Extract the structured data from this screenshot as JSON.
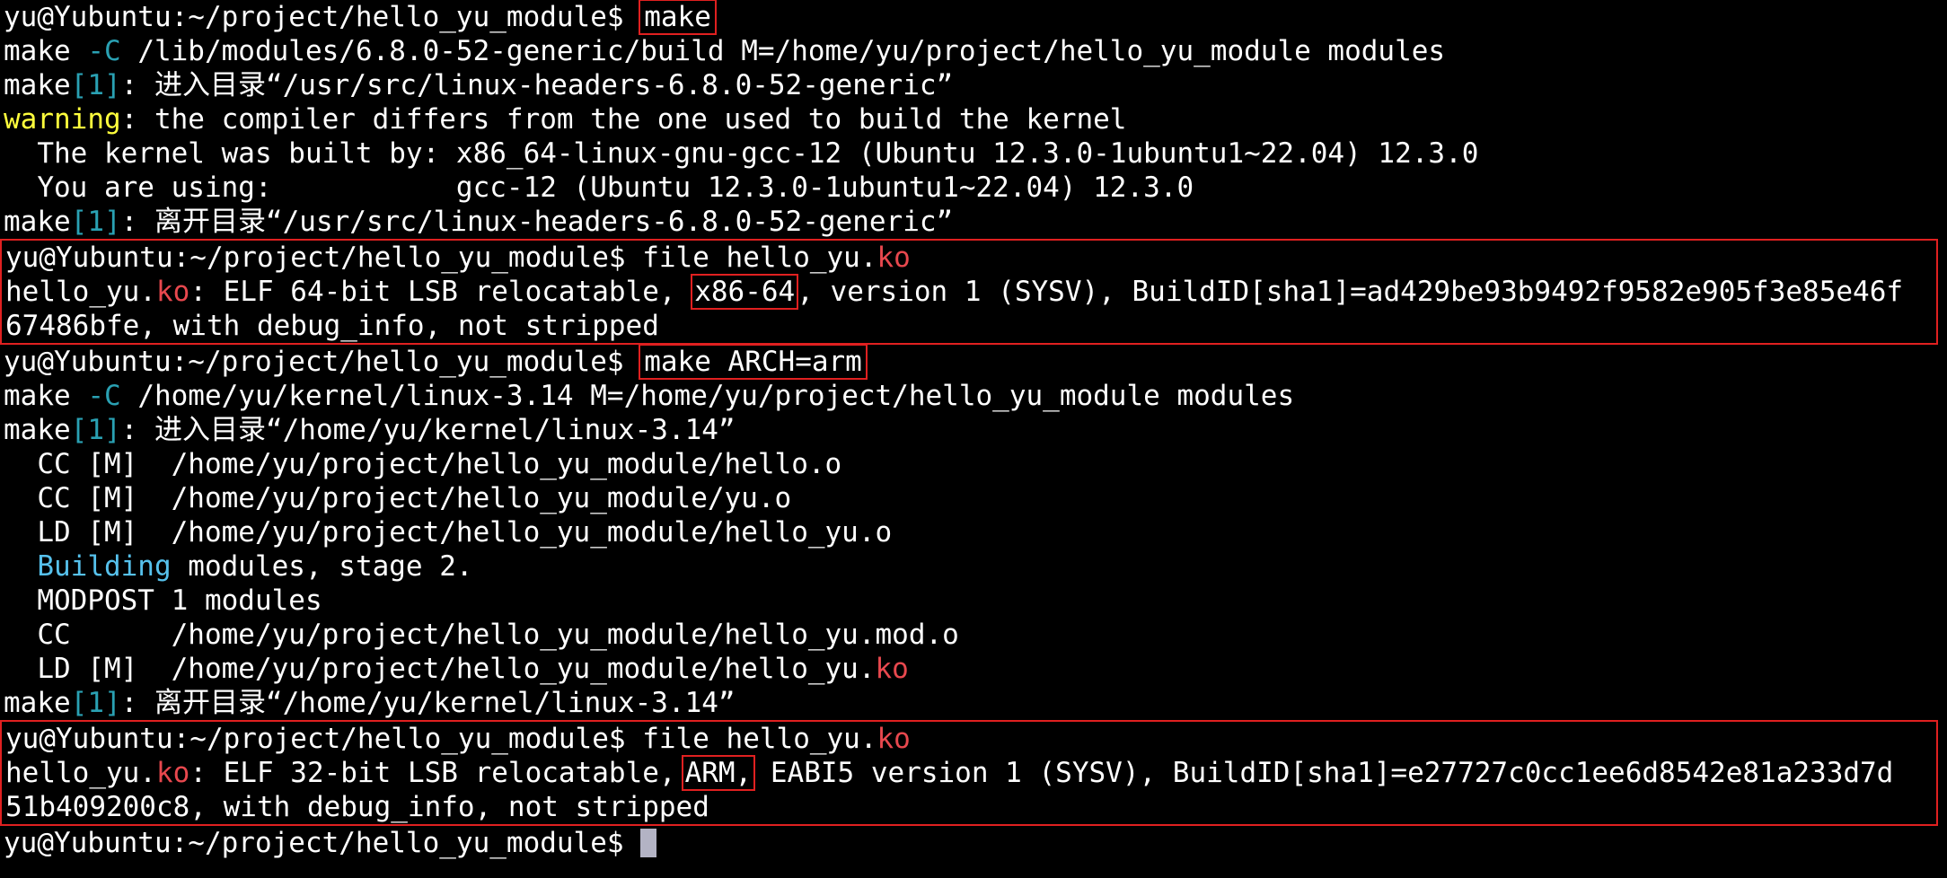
{
  "prompt": "yu@Yubuntu:~/project/hello_yu_module$ ",
  "lines": {
    "l1_cmd": "make",
    "l2": "make -C /lib/modules/6.8.0-52-generic/build M=/home/yu/project/hello_yu_module modules",
    "l2_a": "make ",
    "l2_flag": "-C",
    "l2_b": " /lib/modules/6.8.0-52-generic/build M=/home/yu/project/hello_yu_module modules",
    "l3_a": "make",
    "l3_n": "[1]",
    "l3_b": ": 进入目录“/usr/src/linux-headers-6.8.0-52-generic”",
    "l4_w": "warning",
    "l4_b": ": the compiler differs from the one used to build the kernel",
    "l5": "  The kernel was built by: x86_64-linux-gnu-gcc-12 (Ubuntu 12.3.0-1ubuntu1~22.04) 12.3.0",
    "l6": "  You are using:           gcc-12 (Ubuntu 12.3.0-1ubuntu1~22.04) 12.3.0",
    "l7_a": "make",
    "l7_n": "[1]",
    "l7_b": ": 离开目录“/usr/src/linux-headers-6.8.0-52-generic”",
    "l8_cmd": "file hello_yu.",
    "l8_ext": "ko",
    "l9_a": "hello_yu.",
    "l9_ext": "ko",
    "l9_b": ": ELF 64-bit LSB relocatable, ",
    "l9_arch": "x86-64",
    "l9_c": ", version 1 (SYSV), BuildID[sha1]=ad429be93b9492f9582e905f3e85e46f",
    "l10": "67486bfe, with debug_info, not stripped",
    "l11_cmd": "make ARCH=arm",
    "l12_a": "make ",
    "l12_flag": "-C",
    "l12_b": " /home/yu/kernel/linux-3.14 M=/home/yu/project/hello_yu_module modules",
    "l13_a": "make",
    "l13_n": "[1]",
    "l13_b": ": 进入目录“/home/yu/kernel/linux-3.14”",
    "l14": "  CC [M]  /home/yu/project/hello_yu_module/hello.o",
    "l15": "  CC [M]  /home/yu/project/hello_yu_module/yu.o",
    "l16": "  LD [M]  /home/yu/project/hello_yu_module/hello_yu.o",
    "l17_pre": "  ",
    "l17_w": "Building",
    "l17_b": " modules, stage 2.",
    "l18": "  MODPOST 1 modules",
    "l19": "  CC      /home/yu/project/hello_yu_module/hello_yu.mod.o",
    "l20_a": "  LD [M]  /home/yu/project/hello_yu_module/hello_yu.",
    "l20_ext": "ko",
    "l21_a": "make",
    "l21_n": "[1]",
    "l21_b": ": 离开目录“/home/yu/kernel/linux-3.14”",
    "l22_cmd": "file hello_yu.",
    "l22_ext": "ko",
    "l23_a": "hello_yu.",
    "l23_ext": "ko",
    "l23_b": ": ELF 32-bit LSB relocatable,",
    "l23_arch": "ARM,",
    "l23_c": " EABI5 version 1 (SYSV), BuildID[sha1]=e27727c0cc1ee6d8542e81a233d7d",
    "l24": "51b409200c8, with debug_info, not stripped"
  },
  "colors": {
    "background": "#000000",
    "text": "#ffffff",
    "warning": "#ffff3c",
    "make_level": "#2aa1b3",
    "building": "#56c1ec",
    "ko_ext": "#e8484e",
    "highlight_box": "#e02020",
    "cursor": "#b3b3c4"
  }
}
